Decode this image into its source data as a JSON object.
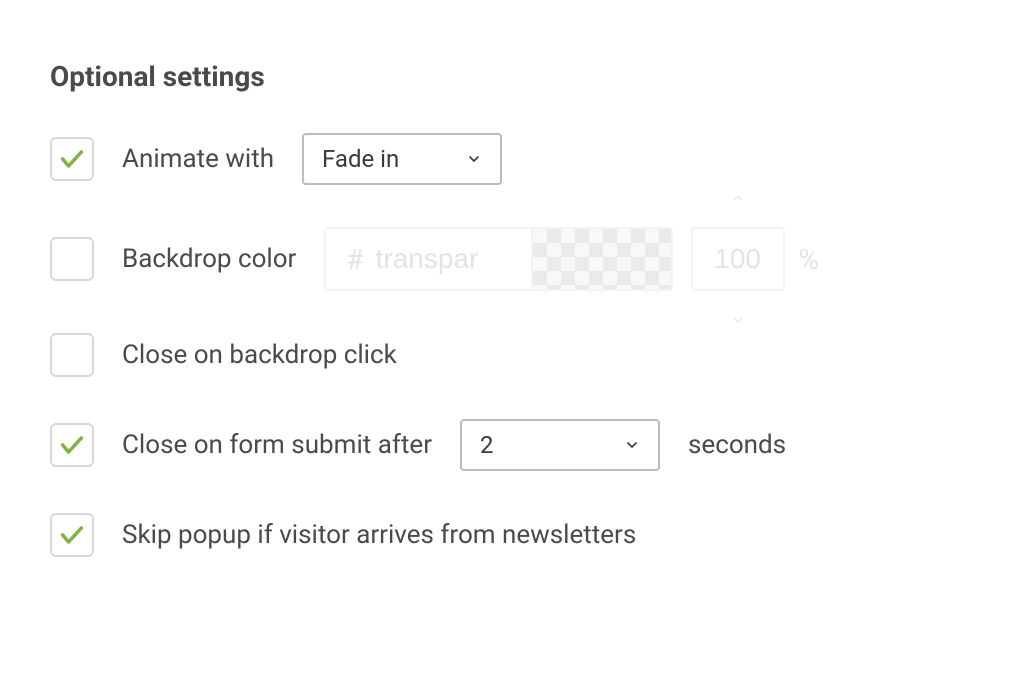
{
  "section_title": "Optional settings",
  "animate": {
    "checked": true,
    "label": "Animate with",
    "select_value": "Fade in"
  },
  "backdrop": {
    "checked": false,
    "label": "Backdrop color",
    "hex_prefix": "#",
    "hex_placeholder": "transpar",
    "opacity_value": "100",
    "percent": "%"
  },
  "close_backdrop": {
    "checked": false,
    "label": "Close on backdrop click"
  },
  "close_submit": {
    "checked": true,
    "label_before": "Close on form submit after",
    "select_value": "2",
    "label_after": "seconds"
  },
  "skip_popup": {
    "checked": true,
    "label": "Skip popup if visitor arrives from newsletters"
  }
}
